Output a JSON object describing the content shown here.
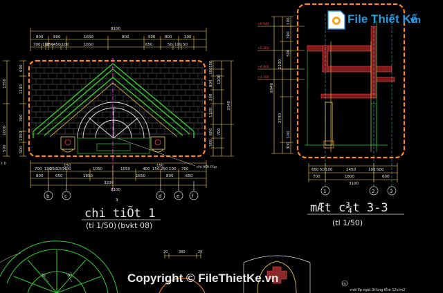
{
  "logo": {
    "text": "File Thiết Kế",
    "domain": ".vn"
  },
  "copyright": "Copyright © FileThietKe.vn",
  "detail": {
    "title": "chi tiÕt 1",
    "scale": "(tl 1/50)",
    "ref": "(bvkt 08)",
    "section_marker": "3",
    "dims_top_row1": [
      "8100"
    ],
    "dims_top_row2": [
      "800",
      "800",
      "1650",
      "800",
      "600",
      "800",
      "200"
    ],
    "dims_top_row3": [
      "700",
      "100",
      "250",
      "450",
      "100",
      "1650",
      "650",
      "50",
      "100",
      "50"
    ],
    "dims_left": [
      "600",
      "1100",
      "300",
      "1050",
      "500",
      "250"
    ],
    "dims_right": [
      "100",
      "300",
      "800",
      "200",
      "1100",
      "1200",
      "3140",
      "600",
      "700",
      "500",
      "2640"
    ],
    "dims_bottom_row1": [
      "150",
      "150"
    ],
    "dims_bottom_row2": [
      "700",
      "100",
      "250",
      "150",
      "400",
      "1050",
      "1050",
      "400",
      "150",
      "250",
      "100",
      "700"
    ],
    "dims_bottom_row3": [
      "800",
      "650",
      "1650",
      "1650",
      "800",
      "650"
    ],
    "dims_bottom_row4": [
      "3200"
    ],
    "dims_bottom_row5": [
      "8100"
    ],
    "grid_labels": [
      "b",
      "c",
      "d",
      "e",
      "f"
    ],
    "callout": "chi tiÕt l¾p",
    "left_marker": "t 0"
  },
  "section": {
    "title": "mÆt c¾t 3-3",
    "scale": "(tl 1/50)",
    "levels": [
      "+6.940",
      "+5.300",
      "+4.900",
      "+3.700"
    ],
    "dims_left": [
      "100",
      "300",
      "500",
      "1100",
      "2740",
      "6940",
      "100",
      "300",
      "100"
    ],
    "dims_bottom_row1": [
      "650",
      "50",
      "100",
      "1450",
      "100",
      "500"
    ],
    "dims_bottom_row2": [
      "700",
      "1800",
      "600"
    ],
    "dims_bottom_row3": [
      "3100"
    ],
    "grid_labels": [
      "1",
      "2",
      "3"
    ]
  },
  "bottom": {
    "dims": [
      "20",
      "380",
      "20"
    ],
    "radial_dims": [
      "22",
      "97"
    ],
    "note": "mãi lîp ngãi 3t¾ng tÊm 12v/m2",
    "section_mark": "m"
  },
  "left_dims": [
    "1350",
    "1000",
    "500"
  ]
}
